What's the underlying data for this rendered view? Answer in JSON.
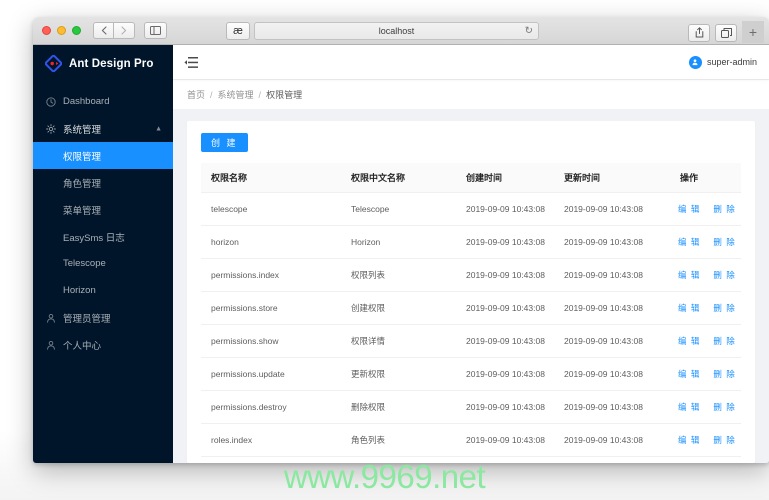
{
  "browser": {
    "url": "localhost",
    "back_icon": "chevron-left-icon",
    "forward_icon": "chevron-right-icon",
    "sidebar_toggle_icon": "sidebar-panel-icon",
    "reader_label": "æ",
    "reload_icon": "reload-icon",
    "share_icon": "share-icon",
    "tabs_icon": "tabs-overview-icon",
    "new_tab_label": "+"
  },
  "sidebar": {
    "brand": "Ant Design Pro",
    "items": [
      {
        "label": "Dashboard",
        "icon": "dashboard-icon",
        "type": "item",
        "selected": false
      },
      {
        "label": "系统管理",
        "icon": "settings-gear-icon",
        "type": "group",
        "selected": false,
        "arrow": "▲"
      },
      {
        "label": "权限管理",
        "icon": "",
        "type": "sub",
        "selected": true
      },
      {
        "label": "角色管理",
        "icon": "",
        "type": "sub",
        "selected": false
      },
      {
        "label": "菜单管理",
        "icon": "",
        "type": "sub",
        "selected": false
      },
      {
        "label": "EasySms 日志",
        "icon": "",
        "type": "sub",
        "selected": false
      },
      {
        "label": "Telescope",
        "icon": "",
        "type": "sub",
        "selected": false
      },
      {
        "label": "Horizon",
        "icon": "",
        "type": "sub",
        "selected": false
      },
      {
        "label": "管理员管理",
        "icon": "user-icon",
        "type": "item",
        "selected": false
      },
      {
        "label": "个人中心",
        "icon": "user-icon",
        "type": "item",
        "selected": false
      }
    ]
  },
  "topbar": {
    "fold_icon": "menu-fold-icon",
    "avatar_icon": "user-avatar-icon",
    "username": "super-admin"
  },
  "breadcrumb": {
    "items": [
      "首页",
      "系统管理",
      "权限管理"
    ],
    "separator": "/"
  },
  "toolbar": {
    "create_label": "创 建"
  },
  "table": {
    "columns": [
      "权限名称",
      "权限中文名称",
      "创建时间",
      "更新时间",
      "操作"
    ],
    "actions": {
      "edit": "编 辑",
      "delete": "删 除"
    },
    "rows": [
      {
        "name": "telescope",
        "cn": "Telescope",
        "created": "2019-09-09 10:43:08",
        "updated": "2019-09-09 10:43:08"
      },
      {
        "name": "horizon",
        "cn": "Horizon",
        "created": "2019-09-09 10:43:08",
        "updated": "2019-09-09 10:43:08"
      },
      {
        "name": "permissions.index",
        "cn": "权限列表",
        "created": "2019-09-09 10:43:08",
        "updated": "2019-09-09 10:43:08"
      },
      {
        "name": "permissions.store",
        "cn": "创建权限",
        "created": "2019-09-09 10:43:08",
        "updated": "2019-09-09 10:43:08"
      },
      {
        "name": "permissions.show",
        "cn": "权限详情",
        "created": "2019-09-09 10:43:08",
        "updated": "2019-09-09 10:43:08"
      },
      {
        "name": "permissions.update",
        "cn": "更新权限",
        "created": "2019-09-09 10:43:08",
        "updated": "2019-09-09 10:43:08"
      },
      {
        "name": "permissions.destroy",
        "cn": "删除权限",
        "created": "2019-09-09 10:43:08",
        "updated": "2019-09-09 10:43:08"
      },
      {
        "name": "roles.index",
        "cn": "角色列表",
        "created": "2019-09-09 10:43:08",
        "updated": "2019-09-09 10:43:08"
      }
    ]
  },
  "watermark": {
    "text": "www.9969.net",
    "color": "#8ae8a0"
  },
  "colors": {
    "sidebar_bg": "#001529",
    "accent": "#1890ff",
    "page_bg": "#f0f2f5",
    "card_bg": "#ffffff"
  }
}
